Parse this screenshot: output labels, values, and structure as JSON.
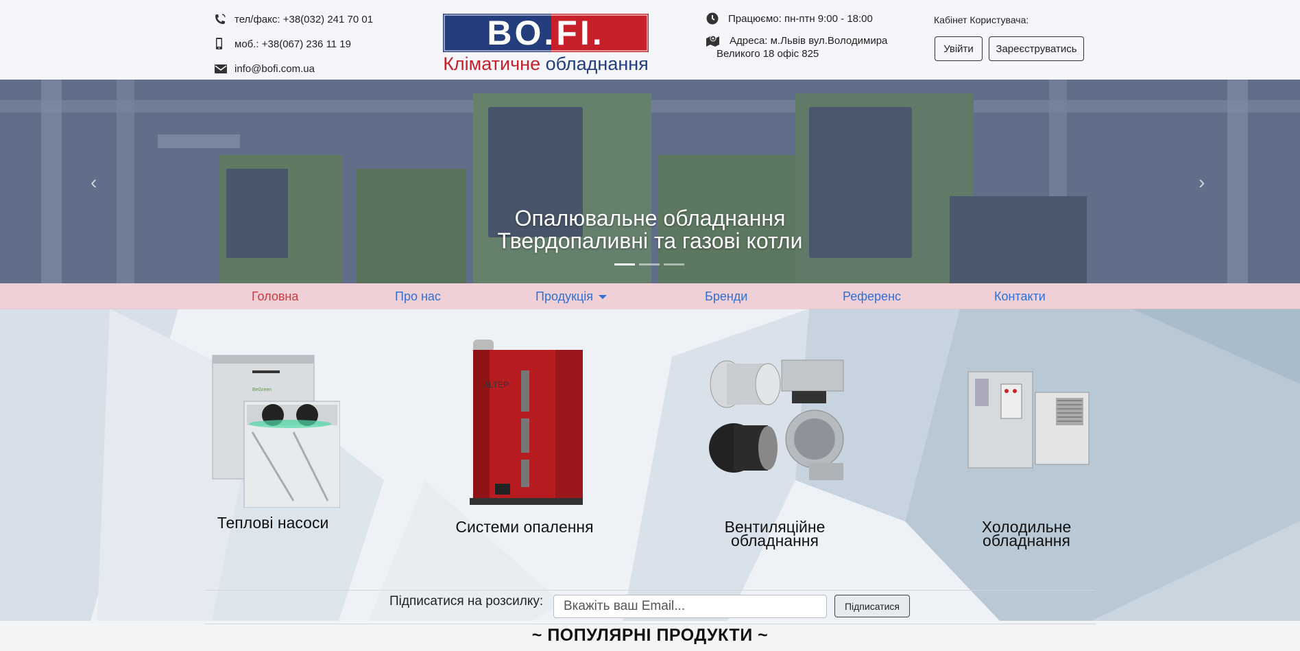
{
  "header": {
    "phone_fax": "тел/факс: +38(032) 241 70 01",
    "mobile": "моб.: +38(067) 236 11 19",
    "email": "info@bofi.com.ua",
    "logo_text": "BO.FI.",
    "logo_sub_red": "Кліматичне",
    "logo_sub_blue": "обладнання",
    "hours": "Працюємо: пн-птн 9:00 - 18:00",
    "address_line1": "Адреса: м.Львів вул.Володимира",
    "address_line2": "Великого 18 офіс 825",
    "cabinet_label": "Кабінет Користувача:",
    "login_label": "Увійти",
    "register_label": "Зареєструватись"
  },
  "hero": {
    "caption_line1": "Опалювальне обладнання",
    "caption_line2": "Твердопаливні та газові котли",
    "slide_count": 3,
    "active_slide": 1
  },
  "nav": {
    "items": [
      {
        "label": "Головна",
        "active": true
      },
      {
        "label": "Про нас"
      },
      {
        "label": "Продукція",
        "dropdown": true
      },
      {
        "label": "Бренди"
      },
      {
        "label": "Референс"
      },
      {
        "label": "Контакти"
      }
    ]
  },
  "products": [
    {
      "label": "Теплові насоси"
    },
    {
      "label": "Системи опалення"
    },
    {
      "label_line1": "Вентиляційне",
      "label_line2": "обладнання"
    },
    {
      "label_line1": "Холодильне",
      "label_line2": "обладнання"
    }
  ],
  "subscribe": {
    "label": "Підписатися на розсилку:",
    "placeholder": "Вкажіть ваш Email...",
    "button": "Підписатися"
  },
  "popular_title": "~ ПОПУЛЯРНІ ПРОДУКТИ ~",
  "colors": {
    "accent_red": "#c8202b",
    "brand_blue": "#233d7d",
    "nav_link": "#2f6fd6"
  }
}
